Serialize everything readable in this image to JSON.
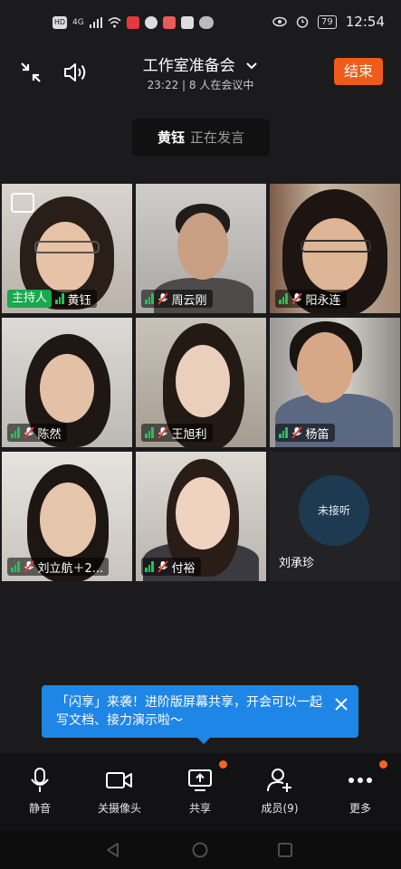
{
  "status": {
    "time": "12:54",
    "battery": "79",
    "left_badges": [
      "HD",
      "4G"
    ]
  },
  "meeting": {
    "title": "工作室准备会",
    "subtitle": "23:22 | 8 人在会议中",
    "end_label": "结束"
  },
  "speaker": {
    "name": "黄钰",
    "status": "正在发言"
  },
  "tiles": [
    {
      "name": "黄钰",
      "host_label": "主持人",
      "muted": false
    },
    {
      "name": "周云刚",
      "muted": true
    },
    {
      "name": "阳永连",
      "muted": true
    },
    {
      "name": "陈然",
      "muted": true
    },
    {
      "name": "王旭利",
      "muted": true
    },
    {
      "name": "杨笛",
      "muted": true
    },
    {
      "name": "刘立航＋2...",
      "muted": true
    },
    {
      "name": "付裕",
      "muted": true
    },
    {
      "name": "刘承珍",
      "not_joined_label": "未接听"
    }
  ],
  "toast": {
    "text": "「闪享」来袭！进阶版屏幕共享，开会可以一起写文档、接力演示啦～"
  },
  "toolbar": {
    "mute": "静音",
    "camera": "关摄像头",
    "share": "共享",
    "members": "成员(9)",
    "more": "更多"
  },
  "colors": {
    "end_button": "#f05a1a",
    "host_badge": "#17a94b",
    "toast": "#1e86e6",
    "notification_dot": "#f26522"
  }
}
